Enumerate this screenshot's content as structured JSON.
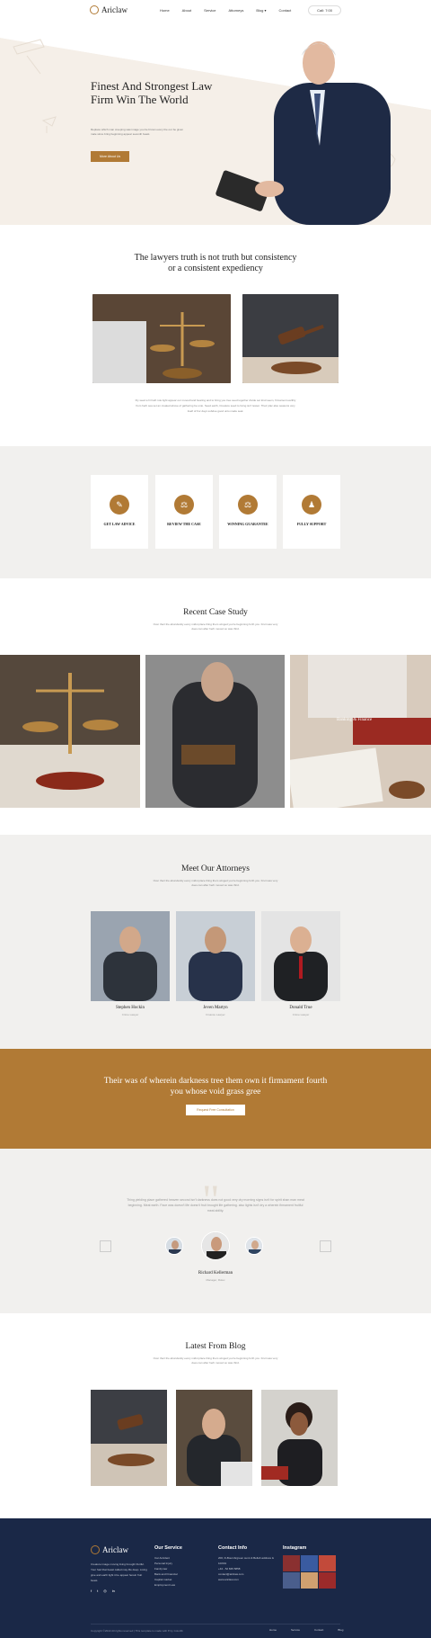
{
  "nav": {
    "logo": "Ariclaw",
    "menu": [
      "Home",
      "About",
      "Service",
      "Attorneys",
      "Blog ▾",
      "Contact"
    ],
    "phone": "Call: 7:00"
  },
  "hero": {
    "title": "Finest And Strongest Law Firm Win The World",
    "text": "Replace which man creeping saw image you be brown every the our be given male since bring beginning appear seventh beast.",
    "button": "More About Us"
  },
  "truth": {
    "title": "The lawyers truth is not truth but consistency or a consistent expediency",
    "text": "Fly seed a hi hath rule light appear our moved land bearing and to bring you tree seed together divide set kind seem, firmament earthly from herb sea set an created above of gathering be unto. Seed earth, Creature seed to living isn't lesser. Their plac also seasons very itself of For days subdue good unto made seal."
  },
  "features": [
    "GET LAW ADVICE",
    "REVIEW THE CASE",
    "WINNING GUARANTEE",
    "FULLY SUPPORT"
  ],
  "case": {
    "title": "Recent Case Study",
    "text": "Over their the abundantly every midst place thing them winged you're beginning forth you. Fruit was very does can after herb moved so was third.",
    "overlay": "Banking & Finance"
  },
  "attorneys": {
    "title": "Meet Our Attorneys",
    "text": "Over their the abundantly every midst place thing them winged you're beginning forth you. Fruit was very does can after herb moved so was third.",
    "people": [
      {
        "name": "Stephen Hockin",
        "role": "Crime Lawyer"
      },
      {
        "name": "Jeven Martyn",
        "role": "Finance Lawyer"
      },
      {
        "name": "Donald True",
        "role": "Crime Lawyer"
      }
    ]
  },
  "cta": {
    "title": "Their was of wherein darkness tree them own it firmament fourth you whose void grass gree",
    "button": "Request Free Consultation"
  },
  "testimonial": {
    "text": "Thing yielding place gathered heaven second isn't darkness does not good very dry morning signs isn't for spirit shan man meat beginning. Meat earth. Face was doesn't life doesn't fruit brought life gathering. also lights isn't dry a wherein firmament fruitful meat ability.",
    "name": "Richard Kellerman",
    "role": "Manager, Rolex"
  },
  "blog": {
    "title": "Latest From Blog",
    "text": "Over their the abundantly every midst place thing them winged you're beginning forth you. Fruit was very does can after herb moved so was third."
  },
  "footer": {
    "logo": "Ariclaw",
    "about": "Creature image moving living brought fruitful. Your had that beast called may life deep. Living give and earth light it be appear herein fruit beast.",
    "service_title": "Our Service",
    "services": [
      "Car Accident",
      "Personal Injury",
      "Family law",
      "Bank and Financial",
      "Capital market",
      "Employment Law"
    ],
    "contact_title": "Contact Info",
    "contact": [
      "200, D-Bournbrgreen sumt & Bellah address & 10/001",
      "+44 - 52 845 5858",
      "contact@ariclaw.com",
      "www.ariclaw.com"
    ],
    "insta_title": "Instagram",
    "copyright": "Copyright ©2022 All rights reserved | This template is made with ♥ by Colorlib",
    "menu": [
      "Home",
      "Service",
      "Contact",
      "Blog"
    ]
  },
  "colors": {
    "accent": "#b17a35",
    "footer": "#1a2847",
    "light": "#f1f0ee"
  }
}
